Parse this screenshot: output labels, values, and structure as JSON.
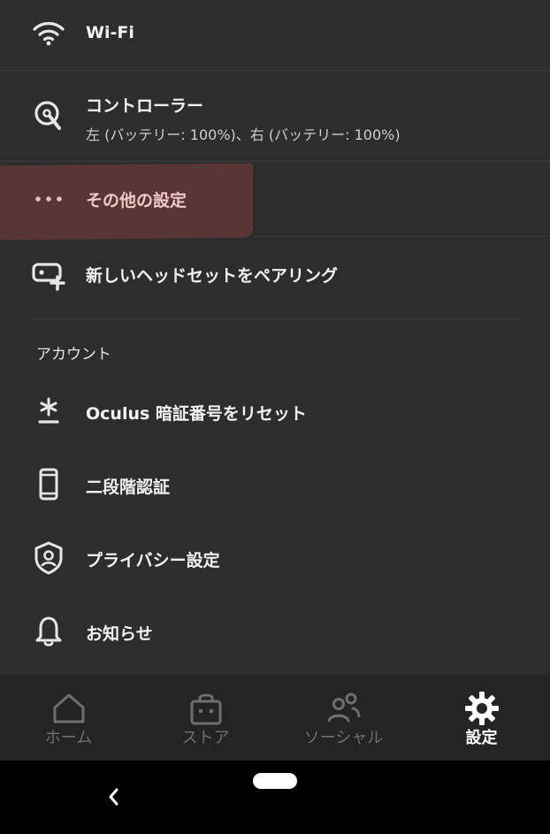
{
  "colors": {
    "background": "#2d2d2d",
    "highlight": "#5a3535",
    "highlight_text": "#f2c9c9",
    "nav_background": "#242424",
    "nav_inactive": "#6f6f6f",
    "nav_active": "#ffffff",
    "system_bar": "#000000"
  },
  "settings": {
    "wifi": {
      "label": "Wi-Fi",
      "icon": "wifi-icon"
    },
    "controller": {
      "label": "コントローラー",
      "detail": "左 (バッテリー: 100%)、右 (バッテリー: 100%)",
      "icon": "controller-icon"
    },
    "more_settings": {
      "label": "その他の設定",
      "icon": "more-dots-icon"
    },
    "pair_headset": {
      "label": "新しいヘッドセットをペアリング",
      "icon": "headset-add-icon"
    }
  },
  "account": {
    "section_title": "アカウント",
    "items": [
      {
        "label": "Oculus 暗証番号をリセット",
        "icon": "asterisk-icon"
      },
      {
        "label": "二段階認証",
        "icon": "phone-icon"
      },
      {
        "label": "プライバシー設定",
        "icon": "shield-user-icon"
      },
      {
        "label": "お知らせ",
        "icon": "bell-icon"
      }
    ]
  },
  "bottom_nav": {
    "items": [
      {
        "label": "ホーム",
        "icon": "home-icon",
        "active": false
      },
      {
        "label": "ストア",
        "icon": "store-bag-icon",
        "active": false
      },
      {
        "label": "ソーシャル",
        "icon": "people-icon",
        "active": false
      },
      {
        "label": "設定",
        "icon": "gear-icon",
        "active": true
      }
    ]
  },
  "system_bar": {
    "back_icon": "back-chevron-icon",
    "home_icon": "home-pill-icon"
  }
}
